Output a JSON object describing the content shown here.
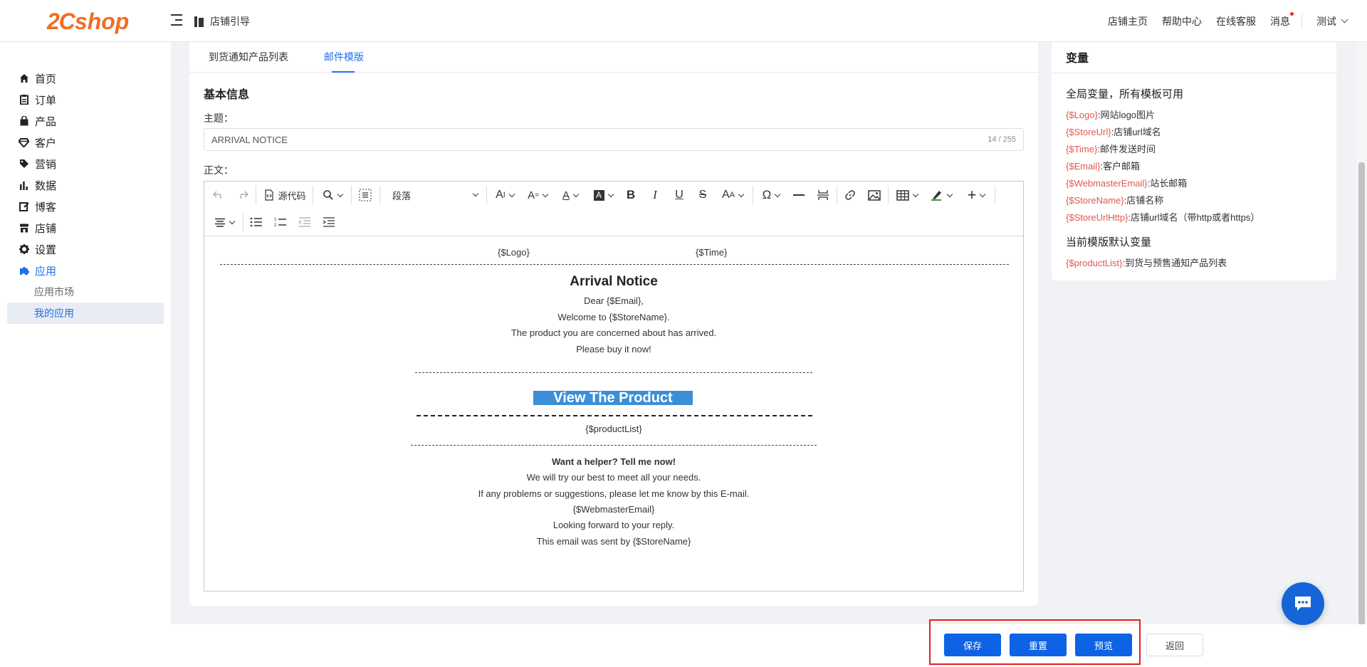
{
  "logo": {
    "part1": "2C",
    "part2": "shop"
  },
  "header": {
    "guide_label": "店铺引导",
    "nav": [
      "店铺主页",
      "帮助中心",
      "在线客服",
      "消息"
    ],
    "user": "测试"
  },
  "sidebar": {
    "items": [
      {
        "label": "首页",
        "icon": "home-icon"
      },
      {
        "label": "订单",
        "icon": "order-icon"
      },
      {
        "label": "产品",
        "icon": "product-icon"
      },
      {
        "label": "客户",
        "icon": "customer-icon"
      },
      {
        "label": "营销",
        "icon": "tag-icon"
      },
      {
        "label": "数据",
        "icon": "chart-icon"
      },
      {
        "label": "博客",
        "icon": "blog-icon"
      },
      {
        "label": "店铺",
        "icon": "store-icon"
      },
      {
        "label": "设置",
        "icon": "gear-icon"
      },
      {
        "label": "应用",
        "icon": "puzzle-icon"
      }
    ],
    "subitems": [
      "应用市场",
      "我的应用"
    ]
  },
  "tabs": [
    "到货通知产品列表",
    "邮件模版"
  ],
  "form": {
    "section_title": "基本信息",
    "subject_label": "主题：",
    "subject_value": "ARRIVAL NOTICE",
    "subject_counter": "14 / 255",
    "body_label": "正文："
  },
  "toolbar": {
    "source_label": "源代码",
    "paragraph_label": "段落"
  },
  "email": {
    "logo_var": "{$Logo}",
    "time_var": "{$Time}",
    "heading": "Arrival Notice",
    "lines1": [
      "Dear {$Email},",
      "Welcome to {$StoreName}.",
      "The product you are concerned about has arrived.",
      "Please buy it now!"
    ],
    "cta": "View The Product",
    "product_list": "{$productList}",
    "helper_title": "Want a helper? Tell me now!",
    "lines2": [
      "We will try our best to meet all your needs.",
      "If any problems or suggestions, please let me know by this E-mail.",
      "{$WebmasterEmail}",
      "Looking forward to your reply.",
      "This email was sent by {$StoreName}"
    ]
  },
  "variables": {
    "title": "变量",
    "global_title": "全局变量，所有模板可用",
    "global": [
      {
        "key": "{$Logo}",
        "desc": ":网站logo图片"
      },
      {
        "key": "{$StoreUrl}",
        "desc": ":店铺url域名"
      },
      {
        "key": "{$Time}",
        "desc": ":邮件发送时间"
      },
      {
        "key": "{$Email}",
        "desc": ":客户邮箱"
      },
      {
        "key": "{$WebmasterEmail}",
        "desc": ":站长邮箱"
      },
      {
        "key": "{$StoreName}",
        "desc": ":店铺名称"
      },
      {
        "key": "{$StoreUrlHttp}",
        "desc": ":店铺url域名（带http或者https）"
      }
    ],
    "template_title": "当前模版默认变量",
    "template": [
      {
        "key": "{$productList}",
        "desc": ":到货与预售通知产品列表"
      }
    ]
  },
  "buttons": {
    "save": "保存",
    "reset": "重置",
    "preview": "预览",
    "back": "返回"
  },
  "colors": {
    "accent": "#1f6feb",
    "primary_button": "#0d62e6",
    "brand": "#f26d21",
    "variable": "#e2574c",
    "highlight_box": "#e02020"
  }
}
